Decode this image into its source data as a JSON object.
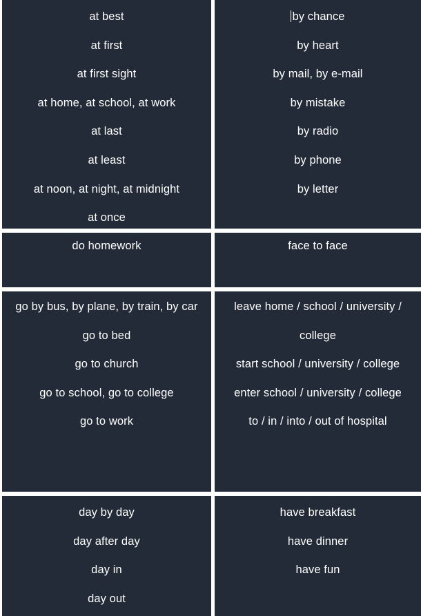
{
  "document": {
    "title": "English Collocations Grid",
    "background_color": "#ffffff",
    "cell_color": "#242b38",
    "text_color": "#ffffff"
  },
  "cells": [
    {
      "id": "at-phrases",
      "position": "row1-left",
      "lines": [
        "at best",
        "at first",
        "at first sight",
        "at home, at school, at work",
        "at last",
        "at least",
        "at noon, at night, at midnight",
        "at once"
      ]
    },
    {
      "id": "by-phrases",
      "position": "row1-right",
      "caret_before_first_line": true,
      "lines": [
        "by chance",
        "by heart",
        "by mail, by e-mail",
        "by mistake",
        "by radio",
        "by phone",
        "by letter"
      ]
    },
    {
      "id": "do-phrases",
      "position": "row2-left",
      "lines": [
        "do homework"
      ]
    },
    {
      "id": "face-phrases",
      "position": "row2-right",
      "lines": [
        "face to face"
      ]
    },
    {
      "id": "go-phrases",
      "position": "row3-left",
      "lines": [
        "go by bus, by plane, by train, by car",
        "go to bed",
        "go to church",
        "go to school, go to college",
        "go to work"
      ]
    },
    {
      "id": "school-phrases",
      "position": "row3-right",
      "lines": [
        "leave home / school / university / college",
        "start school / university / college",
        "enter school / university / college",
        "to / in / into / out of hospital"
      ]
    },
    {
      "id": "day-phrases",
      "position": "row4-left",
      "lines": [
        "day by day",
        "day after day",
        "day in",
        "day out"
      ]
    },
    {
      "id": "have-phrases",
      "position": "row4-right",
      "lines": [
        "have breakfast",
        "have dinner",
        "have fun"
      ]
    }
  ]
}
